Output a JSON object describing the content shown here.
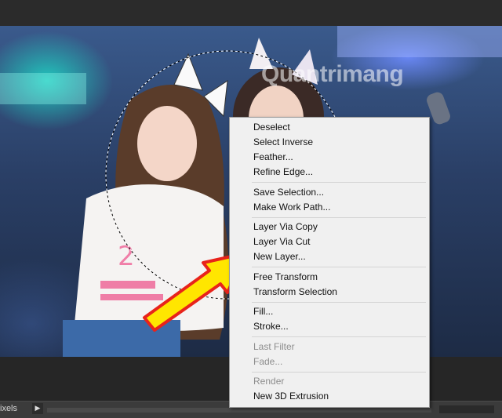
{
  "watermark": "Quantrimang",
  "status": {
    "units_text": "ixels",
    "arrow": "▶"
  },
  "menu": {
    "items": [
      {
        "label": "Deselect",
        "disabled": false
      },
      {
        "label": "Select Inverse",
        "disabled": false
      },
      {
        "label": "Feather...",
        "disabled": false
      },
      {
        "label": "Refine Edge...",
        "disabled": false
      },
      {
        "label": "Save Selection...",
        "disabled": false
      },
      {
        "label": "Make Work Path...",
        "disabled": false
      },
      {
        "label": "Layer Via Copy",
        "disabled": false
      },
      {
        "label": "Layer Via Cut",
        "disabled": false
      },
      {
        "label": "New Layer...",
        "disabled": false
      },
      {
        "label": "Free Transform",
        "disabled": false
      },
      {
        "label": "Transform Selection",
        "disabled": false
      },
      {
        "label": "Fill...",
        "disabled": false
      },
      {
        "label": "Stroke...",
        "disabled": false
      },
      {
        "label": "Last Filter",
        "disabled": true
      },
      {
        "label": "Fade...",
        "disabled": true
      },
      {
        "label": "Render",
        "disabled": true
      },
      {
        "label": "New 3D Extrusion",
        "disabled": false
      }
    ]
  },
  "colors": {
    "arrow_fill": "#ffe600",
    "arrow_outline": "#e8231b",
    "menu_bg": "#f0f0f0"
  }
}
